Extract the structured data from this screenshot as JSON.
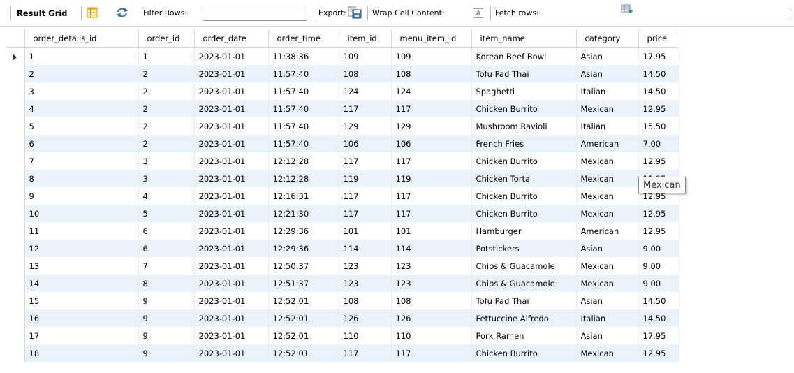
{
  "toolbar": {
    "result_grid": "Result Grid",
    "filter_rows": "Filter Rows:",
    "filter_value": "",
    "export": "Export:",
    "wrap_cell": "Wrap Cell Content:",
    "fetch_rows": "Fetch rows:"
  },
  "grid": {
    "columns": [
      "order_details_id",
      "order_id",
      "order_date",
      "order_time",
      "item_id",
      "menu_item_id",
      "item_name",
      "category",
      "price"
    ],
    "rows": [
      [
        "1",
        "1",
        "2023-01-01",
        "11:38:36",
        "109",
        "109",
        "Korean Beef Bowl",
        "Asian",
        "17.95"
      ],
      [
        "2",
        "2",
        "2023-01-01",
        "11:57:40",
        "108",
        "108",
        "Tofu Pad Thai",
        "Asian",
        "14.50"
      ],
      [
        "3",
        "2",
        "2023-01-01",
        "11:57:40",
        "124",
        "124",
        "Spaghetti",
        "Italian",
        "14.50"
      ],
      [
        "4",
        "2",
        "2023-01-01",
        "11:57:40",
        "117",
        "117",
        "Chicken Burrito",
        "Mexican",
        "12.95"
      ],
      [
        "5",
        "2",
        "2023-01-01",
        "11:57:40",
        "129",
        "129",
        "Mushroom Ravioli",
        "Italian",
        "15.50"
      ],
      [
        "6",
        "2",
        "2023-01-01",
        "11:57:40",
        "106",
        "106",
        "French Fries",
        "American",
        "7.00"
      ],
      [
        "7",
        "3",
        "2023-01-01",
        "12:12:28",
        "117",
        "117",
        "Chicken Burrito",
        "Mexican",
        "12.95"
      ],
      [
        "8",
        "3",
        "2023-01-01",
        "12:12:28",
        "119",
        "119",
        "Chicken Torta",
        "Mexican",
        "11.95"
      ],
      [
        "9",
        "4",
        "2023-01-01",
        "12:16:31",
        "117",
        "117",
        "Chicken Burrito",
        "Mexican",
        "12.95"
      ],
      [
        "10",
        "5",
        "2023-01-01",
        "12:21:30",
        "117",
        "117",
        "Chicken Burrito",
        "Mexican",
        "12.95"
      ],
      [
        "11",
        "6",
        "2023-01-01",
        "12:29:36",
        "101",
        "101",
        "Hamburger",
        "American",
        "12.95"
      ],
      [
        "12",
        "6",
        "2023-01-01",
        "12:29:36",
        "114",
        "114",
        "Potstickers",
        "Asian",
        "9.00"
      ],
      [
        "13",
        "7",
        "2023-01-01",
        "12:50:37",
        "123",
        "123",
        "Chips & Guacamole",
        "Mexican",
        "9.00"
      ],
      [
        "14",
        "8",
        "2023-01-01",
        "12:51:37",
        "123",
        "123",
        "Chips & Guacamole",
        "Mexican",
        "9.00"
      ],
      [
        "15",
        "9",
        "2023-01-01",
        "12:52:01",
        "108",
        "108",
        "Tofu Pad Thai",
        "Asian",
        "14.50"
      ],
      [
        "16",
        "9",
        "2023-01-01",
        "12:52:01",
        "126",
        "126",
        "Fettuccine Alfredo",
        "Italian",
        "14.50"
      ],
      [
        "17",
        "9",
        "2023-01-01",
        "12:52:01",
        "110",
        "110",
        "Pork Ramen",
        "Asian",
        "17.95"
      ],
      [
        "18",
        "9",
        "2023-01-01",
        "12:52:01",
        "117",
        "117",
        "Chicken Burrito",
        "Mexican",
        "12.95"
      ]
    ]
  },
  "tooltip": {
    "text": "Mexican"
  },
  "icons": {
    "grid_view": "grid-view-icon",
    "refresh": "refresh-icon",
    "export": "export-icon",
    "wrap": "wrap-cell-icon",
    "fetch": "fetch-rows-icon"
  },
  "colors": {
    "stripe": "#eaf2fb",
    "accent_blue": "#2f6fb5"
  }
}
